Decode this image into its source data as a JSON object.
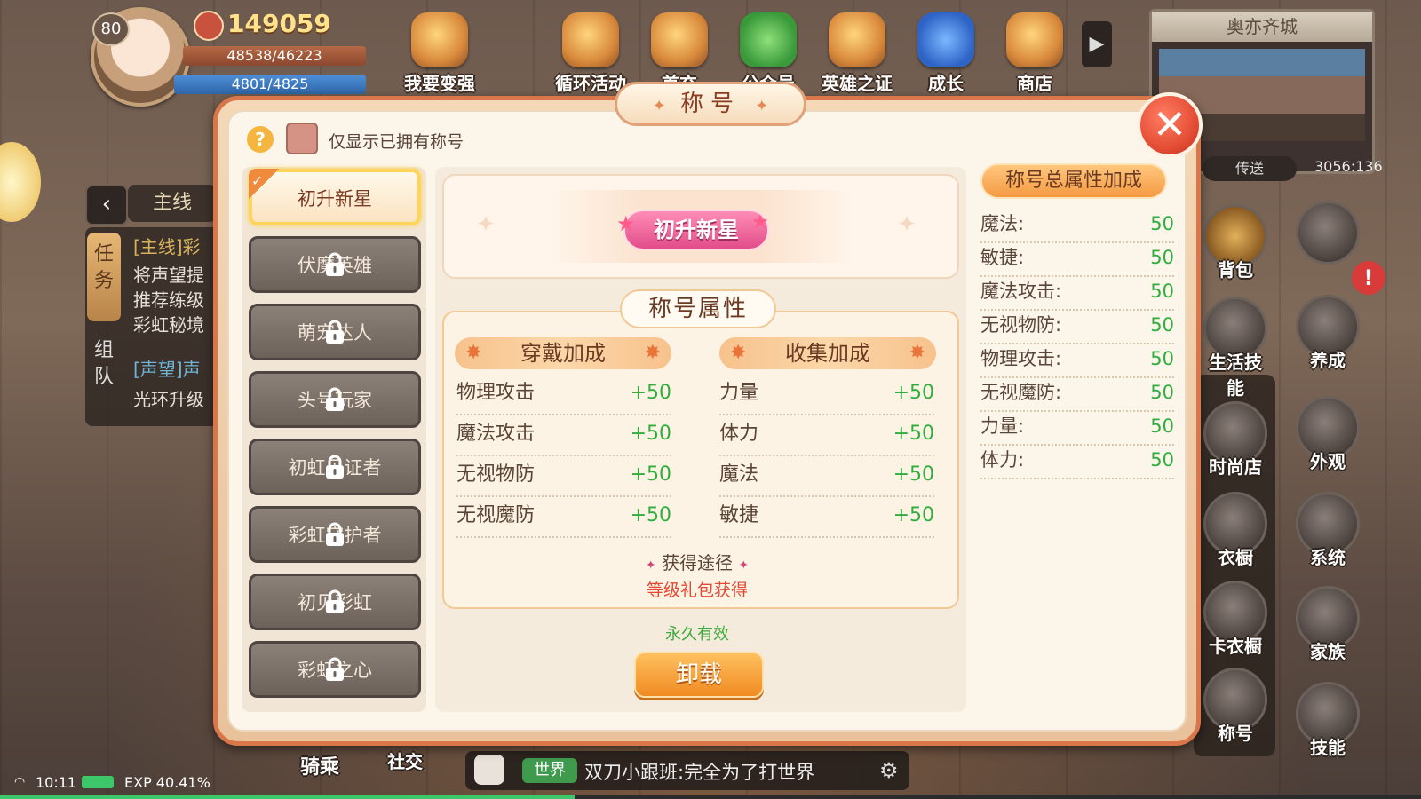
{
  "hud": {
    "level": "80",
    "coins": "149059",
    "hp": "48538/46223",
    "mp": "4801/4825",
    "top_icons": [
      "我要变强",
      "循环活动",
      "首充",
      "公众号",
      "英雄之证",
      "成长",
      "商店"
    ],
    "map_name": "奥亦齐城",
    "teleport": "传送",
    "coords": "3056:136"
  },
  "quest": {
    "back_icon": "chevron-left-icon",
    "tab": "主线",
    "vtab_task": "任务",
    "vtab_team": "组队",
    "lines": [
      "[主线]彩",
      "将声望提",
      "推荐练级",
      "彩虹秘境",
      "[声望]声",
      "光环升级"
    ]
  },
  "right_buttons": [
    "背包",
    "养成",
    "生活技能",
    "外观",
    "时尚店",
    "系统",
    "衣橱",
    "卡衣橱",
    "家族",
    "称号",
    "技能"
  ],
  "bottom": {
    "mount": "骑乘",
    "social": "社交",
    "chat_channel": "世界",
    "chat_message": "双刀小跟班:完全为了打世界",
    "time": "10:11",
    "exp": "EXP 40.41%"
  },
  "modal": {
    "title": "称号",
    "help": "?",
    "filter_label": "仅显示已拥有称号",
    "titles": [
      {
        "label": "初升新星",
        "locked": false,
        "selected": true
      },
      {
        "label": "伏魔英雄",
        "locked": true
      },
      {
        "label": "萌宠达人",
        "locked": true
      },
      {
        "label": "头号玩家",
        "locked": true
      },
      {
        "label": "初虹见证者",
        "locked": true
      },
      {
        "label": "彩虹守护者",
        "locked": true
      },
      {
        "label": "初见彩虹",
        "locked": true
      },
      {
        "label": "彩虹之心",
        "locked": true
      }
    ],
    "badge_text": "初升新星",
    "attr_title": "称号属性",
    "wear_head": "穿戴加成",
    "collect_head": "收集加成",
    "wear": [
      {
        "k": "物理攻击",
        "v": "+50"
      },
      {
        "k": "魔法攻击",
        "v": "+50"
      },
      {
        "k": "无视物防",
        "v": "+50"
      },
      {
        "k": "无视魔防",
        "v": "+50"
      }
    ],
    "collect": [
      {
        "k": "力量",
        "v": "+50"
      },
      {
        "k": "体力",
        "v": "+50"
      },
      {
        "k": "魔法",
        "v": "+50"
      },
      {
        "k": "敏捷",
        "v": "+50"
      }
    ],
    "source_title": "获得途径",
    "source_value": "等级礼包获得",
    "duration": "永久有效",
    "unload": "卸载",
    "sum_head": "称号总属性加成",
    "sum": [
      {
        "k": "魔法:",
        "v": "50"
      },
      {
        "k": "敏捷:",
        "v": "50"
      },
      {
        "k": "魔法攻击:",
        "v": "50"
      },
      {
        "k": "无视物防:",
        "v": "50"
      },
      {
        "k": "物理攻击:",
        "v": "50"
      },
      {
        "k": "无视魔防:",
        "v": "50"
      },
      {
        "k": "力量:",
        "v": "50"
      },
      {
        "k": "体力:",
        "v": "50"
      }
    ]
  },
  "colors": {
    "accent": "#e24a33",
    "positive": "#2fae3c",
    "gold": "#ffd45a"
  },
  "exp_fraction": 0.4041
}
